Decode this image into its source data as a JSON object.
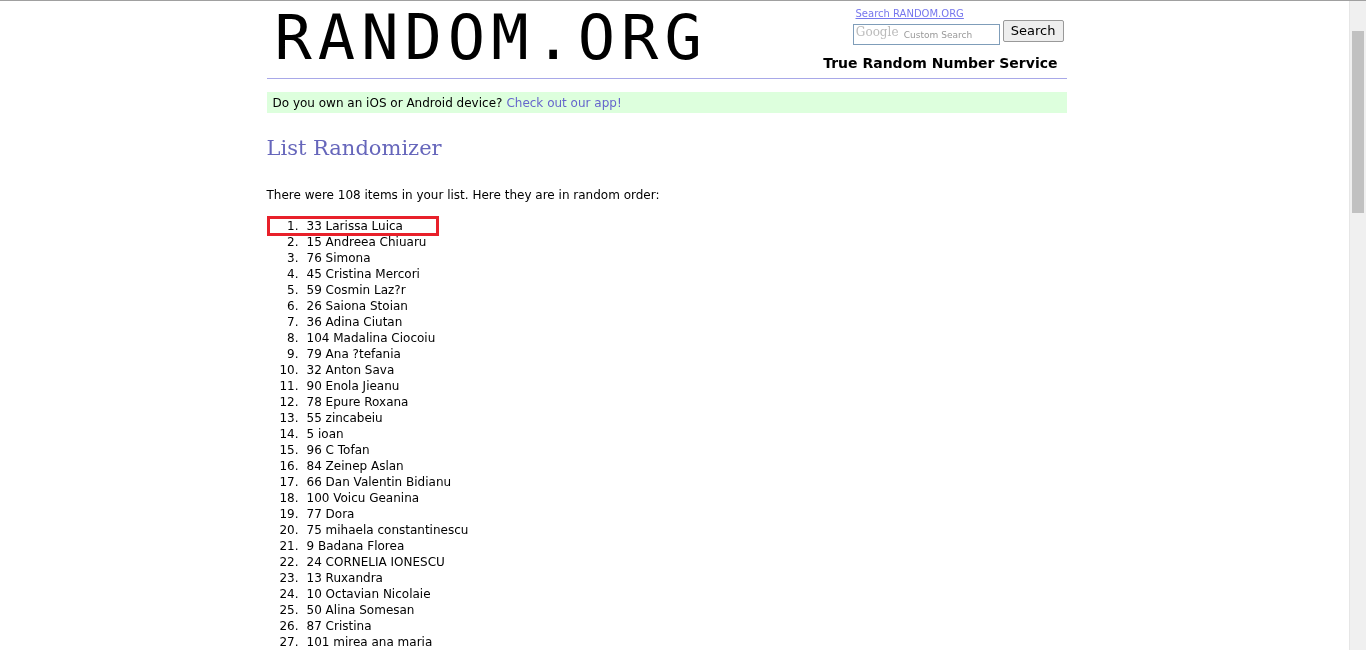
{
  "header": {
    "logo": "RANDOM.ORG",
    "search_link": "Search RANDOM.ORG",
    "search_field": {
      "placeholder": "Custom Search",
      "brand": "Google"
    },
    "search_button": "Search",
    "tagline": "True Random Number Service"
  },
  "banner": {
    "text": "Do you own an iOS or Android device?",
    "link": "Check out our app!"
  },
  "heading": "List Randomizer",
  "intro": "There were 108 items in your list. Here they are in random order:",
  "items": [
    {
      "number": "1.",
      "text": "33 Larissa Luica",
      "highlighted": true
    },
    {
      "number": "2.",
      "text": "15 Andreea Chiuaru",
      "highlighted": false
    },
    {
      "number": "3.",
      "text": "76 Simona",
      "highlighted": false
    },
    {
      "number": "4.",
      "text": "45 Cristina Mercori",
      "highlighted": false
    },
    {
      "number": "5.",
      "text": "59 Cosmin Laz?r",
      "highlighted": false
    },
    {
      "number": "6.",
      "text": "26 Saiona Stoian",
      "highlighted": false
    },
    {
      "number": "7.",
      "text": "36 Adina Ciutan",
      "highlighted": false
    },
    {
      "number": "8.",
      "text": "104 Madalina Ciocoiu",
      "highlighted": false
    },
    {
      "number": "9.",
      "text": "79 Ana ?tefania",
      "highlighted": false
    },
    {
      "number": "10.",
      "text": "32 Anton Sava",
      "highlighted": false
    },
    {
      "number": "11.",
      "text": "90 Enola Jieanu",
      "highlighted": false
    },
    {
      "number": "12.",
      "text": "78 Epure Roxana",
      "highlighted": false
    },
    {
      "number": "13.",
      "text": "55 zincabeiu",
      "highlighted": false
    },
    {
      "number": "14.",
      "text": "5 ioan",
      "highlighted": false
    },
    {
      "number": "15.",
      "text": "96 C Tofan",
      "highlighted": false
    },
    {
      "number": "16.",
      "text": "84 Zeinep Aslan",
      "highlighted": false
    },
    {
      "number": "17.",
      "text": "66 Dan Valentin Bidianu",
      "highlighted": false
    },
    {
      "number": "18.",
      "text": "100 Voicu Geanina",
      "highlighted": false
    },
    {
      "number": "19.",
      "text": "77 Dora",
      "highlighted": false
    },
    {
      "number": "20.",
      "text": "75 mihaela constantinescu",
      "highlighted": false
    },
    {
      "number": "21.",
      "text": "9 Badana Florea",
      "highlighted": false
    },
    {
      "number": "22.",
      "text": "24 CORNELIA IONESCU",
      "highlighted": false
    },
    {
      "number": "23.",
      "text": "13 Ruxandra",
      "highlighted": false
    },
    {
      "number": "24.",
      "text": "10 Octavian Nicolaie",
      "highlighted": false
    },
    {
      "number": "25.",
      "text": "50 Alina Somesan",
      "highlighted": false
    },
    {
      "number": "26.",
      "text": "87 Cristina",
      "highlighted": false
    },
    {
      "number": "27.",
      "text": "101 mirea ana maria",
      "highlighted": false
    }
  ]
}
